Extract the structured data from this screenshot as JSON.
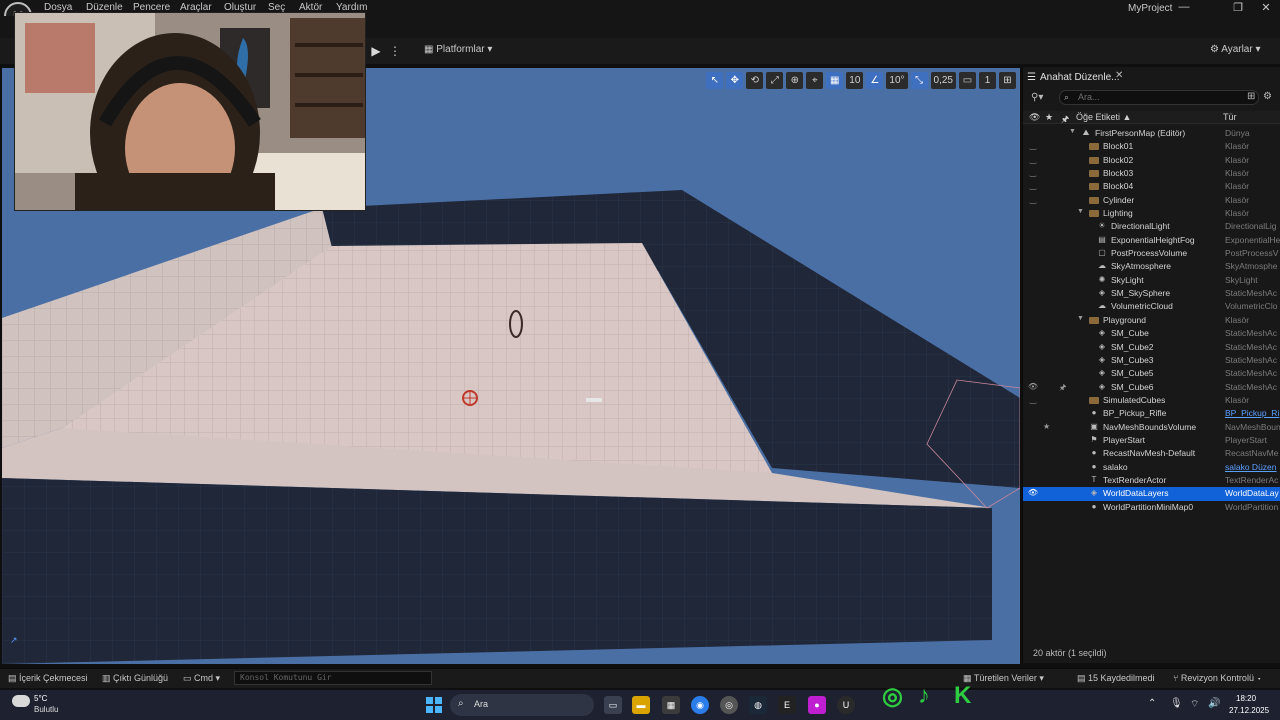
{
  "menu": {
    "items": [
      "Dosya",
      "Düzenle",
      "Pencere",
      "Araçlar",
      "Oluştur",
      "Seç",
      "Aktör",
      "Yardım"
    ],
    "project": "MyProject"
  },
  "toolbar": {
    "platforms": "Platformlar",
    "settings": "Ayarlar"
  },
  "viewport": {
    "grid_size": "10",
    "rotation_snap": "10°",
    "scale_snap": "0,25",
    "camera_speed": "1"
  },
  "outliner": {
    "tab_title": "Anahat Düzenle...",
    "search_placeholder": "Ara...",
    "col_label": "Öğe Etiketi ▲",
    "col_type": "Tür",
    "footer": "20 aktör (1 seçildi)",
    "rows": [
      {
        "label": "FirstPersonMap (Editör)",
        "type": "Dünya",
        "indent": 0,
        "icon": "level",
        "arrow": "▼",
        "eye": ""
      },
      {
        "label": "Block01",
        "type": "Klasör",
        "indent": 1,
        "icon": "folder",
        "eye": "‿"
      },
      {
        "label": "Block02",
        "type": "Klasör",
        "indent": 1,
        "icon": "folder",
        "eye": "‿"
      },
      {
        "label": "Block03",
        "type": "Klasör",
        "indent": 1,
        "icon": "folder",
        "eye": "‿"
      },
      {
        "label": "Block04",
        "type": "Klasör",
        "indent": 1,
        "icon": "folder",
        "eye": "‿"
      },
      {
        "label": "Cylinder",
        "type": "Klasör",
        "indent": 1,
        "icon": "folder",
        "eye": "‿"
      },
      {
        "label": "Lighting",
        "type": "Klasör",
        "indent": 1,
        "icon": "folder",
        "arrow": "▼",
        "eye": ""
      },
      {
        "label": "DirectionalLight",
        "type": "DirectionalLig",
        "indent": 2,
        "icon": "☀",
        "eye": ""
      },
      {
        "label": "ExponentialHeightFog",
        "type": "ExponentialHe",
        "indent": 2,
        "icon": "▤",
        "eye": ""
      },
      {
        "label": "PostProcessVolume",
        "type": "PostProcessV",
        "indent": 2,
        "icon": "▢",
        "eye": ""
      },
      {
        "label": "SkyAtmosphere",
        "type": "SkyAtmosphe",
        "indent": 2,
        "icon": "☁",
        "eye": ""
      },
      {
        "label": "SkyLight",
        "type": "SkyLight",
        "indent": 2,
        "icon": "✺",
        "eye": ""
      },
      {
        "label": "SM_SkySphere",
        "type": "StaticMeshAc",
        "indent": 2,
        "icon": "◈",
        "eye": ""
      },
      {
        "label": "VolumetricCloud",
        "type": "VolumetricClo",
        "indent": 2,
        "icon": "☁",
        "eye": ""
      },
      {
        "label": "Playground",
        "type": "Klasör",
        "indent": 1,
        "icon": "folder",
        "arrow": "▼",
        "eye": ""
      },
      {
        "label": "SM_Cube",
        "type": "StaticMeshAc",
        "indent": 2,
        "icon": "◈",
        "eye": ""
      },
      {
        "label": "SM_Cube2",
        "type": "StaticMeshAc",
        "indent": 2,
        "icon": "◈",
        "eye": ""
      },
      {
        "label": "SM_Cube3",
        "type": "StaticMeshAc",
        "indent": 2,
        "icon": "◈",
        "eye": ""
      },
      {
        "label": "SM_Cube5",
        "type": "StaticMeshAc",
        "indent": 2,
        "icon": "◈",
        "eye": ""
      },
      {
        "label": "SM_Cube6",
        "type": "StaticMeshAc",
        "indent": 2,
        "icon": "◈",
        "eye": "👁",
        "pin": "🖈"
      },
      {
        "label": "SimulatedCubes",
        "type": "Klasör",
        "indent": 1,
        "icon": "folder",
        "eye": "‿"
      },
      {
        "label": "BP_Pickup_Rifle",
        "type": "BP_Pickup_Ri",
        "indent": 1,
        "icon": "●",
        "eye": "",
        "link": true
      },
      {
        "label": "NavMeshBoundsVolume",
        "type": "NavMeshBoun",
        "indent": 1,
        "icon": "▣",
        "eye": "",
        "star": "★"
      },
      {
        "label": "PlayerStart",
        "type": "PlayerStart",
        "indent": 1,
        "icon": "⚑",
        "eye": ""
      },
      {
        "label": "RecastNavMesh-Default",
        "type": "RecastNavMe",
        "indent": 1,
        "icon": "●",
        "eye": ""
      },
      {
        "label": "salako",
        "type": "salako Düzen",
        "indent": 1,
        "icon": "●",
        "eye": "",
        "link": true
      },
      {
        "label": "TextRenderActor",
        "type": "TextRenderAc",
        "indent": 1,
        "icon": "T",
        "eye": ""
      },
      {
        "label": "WorldDataLayers",
        "type": "WorldDataLay",
        "indent": 1,
        "icon": "◈",
        "eye": "👁",
        "selected": true
      },
      {
        "label": "WorldPartitionMiniMap0",
        "type": "WorldPartition",
        "indent": 1,
        "icon": "●",
        "eye": ""
      }
    ]
  },
  "bottombar": {
    "content_drawer": "İçerik Çekmecesi",
    "output_log": "Çıktı Günlüğü",
    "cmd": "Cmd",
    "console_placeholder": "Konsol Komutunu Gir",
    "derived_data": "Türetilen Veriler",
    "unsaved": "15 Kaydedilmedi",
    "revision": "Revizyon Kontrolü"
  },
  "taskbar": {
    "temperature": "5°C",
    "weather": "Bulutlu",
    "search": "Ara",
    "time": "18:20",
    "date": "27.12.2025"
  },
  "colors": {
    "viewport_sky": "#4a6fa5",
    "selection": "#1162d8",
    "floor": "#d8c7c4",
    "wall_dark": "#1d2535"
  }
}
